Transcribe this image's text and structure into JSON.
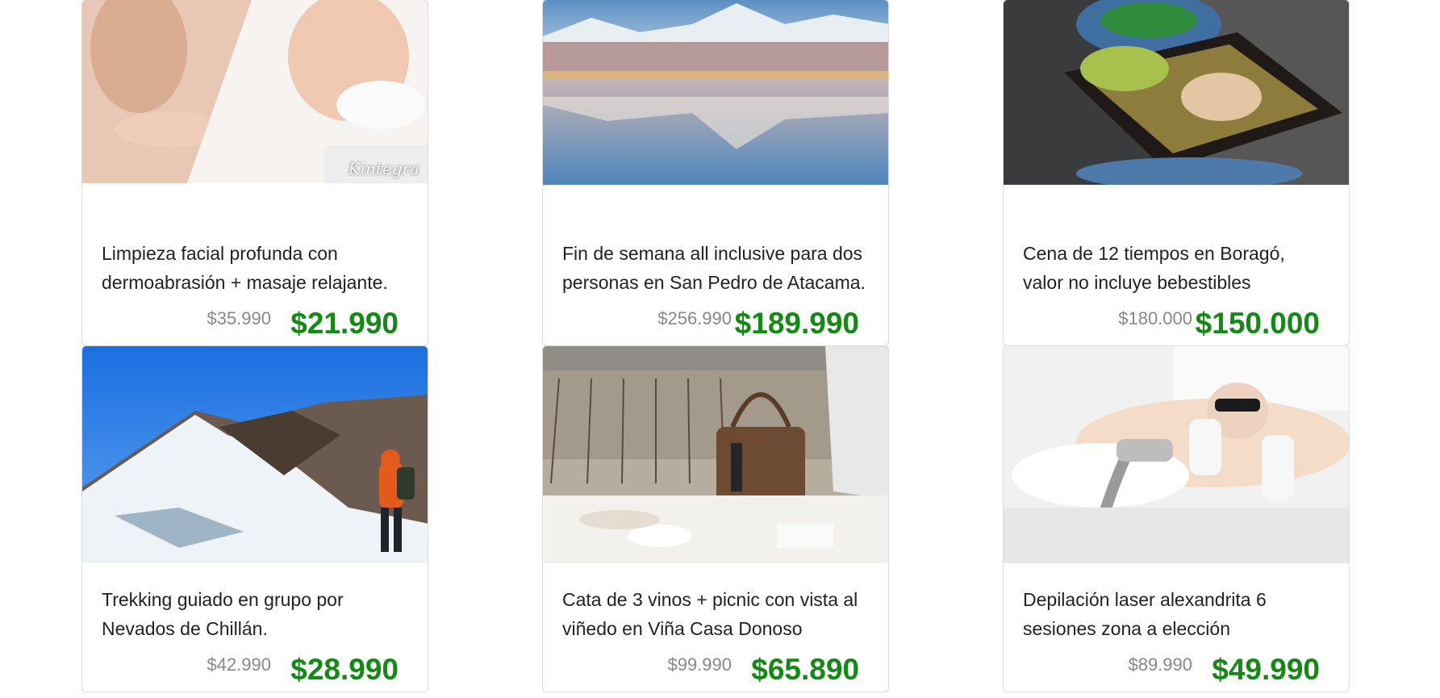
{
  "deals": [
    {
      "title": "Limpieza facial profunda con dermoabrasión + masaje relajante.",
      "old_price": "$35.990",
      "price": "$21.990",
      "image": "spa-facial-treatment-photo",
      "watermark": "Kintegra"
    },
    {
      "title": "Fin de semana all inclusive para dos personas en San Pedro de Atacama.",
      "old_price": "$256.990",
      "price": "$189.990",
      "image": "atacama-lagoon-photo"
    },
    {
      "title": "Cena de 12 tiempos en Boragó, valor no incluye bebestibles",
      "old_price": "$180.000",
      "price": "$150.000",
      "image": "gourmet-dish-photo"
    },
    {
      "title": "Trekking guiado en grupo por Nevados de Chillán.",
      "old_price": "$42.990",
      "price": "$28.990",
      "image": "snow-mountain-hiker-photo"
    },
    {
      "title": "Cata de 3 vinos + picnic con vista al viñedo en Viña Casa Donoso",
      "old_price": "$99.990",
      "price": "$65.890",
      "image": "vineyard-picnic-photo"
    },
    {
      "title": "Depilación laser alexandrita 6 sesiones zona a elección",
      "old_price": "$89.990",
      "price": "$49.990",
      "image": "laser-hair-removal-photo"
    }
  ],
  "colors": {
    "price": "#138a13",
    "old_price": "#888888",
    "border": "#dcdcdc"
  }
}
